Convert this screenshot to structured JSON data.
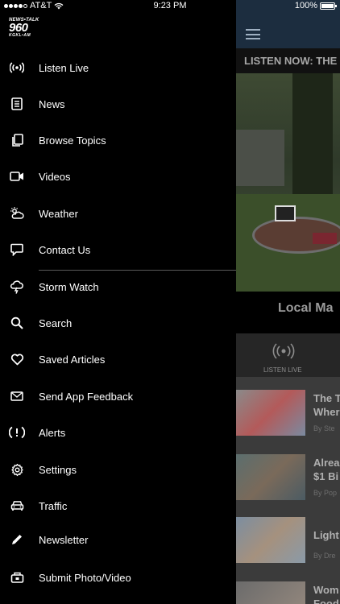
{
  "status_bar": {
    "carrier": "AT&T",
    "time": "9:23 PM",
    "battery": "100%"
  },
  "logo": {
    "line1": "NEWS•TALK",
    "line2": "960",
    "line3": "KGKL•AM"
  },
  "menu": [
    {
      "label": "Listen Live",
      "icon": "radio-broadcast-icon"
    },
    {
      "label": "News",
      "icon": "document-icon"
    },
    {
      "label": "Browse Topics",
      "icon": "copy-pages-icon"
    },
    {
      "label": "Videos",
      "icon": "video-camera-icon"
    },
    {
      "label": "Weather",
      "icon": "weather-icon"
    },
    {
      "label": "Contact Us",
      "icon": "chat-bubble-icon"
    },
    {
      "label": "Storm Watch",
      "icon": "storm-icon"
    },
    {
      "label": "Search",
      "icon": "search-icon"
    },
    {
      "label": "Saved Articles",
      "icon": "heart-icon"
    },
    {
      "label": "Send App Feedback",
      "icon": "envelope-icon"
    },
    {
      "label": "Alerts",
      "icon": "alert-icon"
    },
    {
      "label": "Settings",
      "icon": "gear-icon"
    },
    {
      "label": "Traffic",
      "icon": "car-icon"
    },
    {
      "label": "Newsletter",
      "icon": "pencil-icon"
    },
    {
      "label": "Submit Photo/Video",
      "icon": "camera-upload-icon"
    }
  ],
  "app": {
    "banner": "LISTEN NOW: THE",
    "hero_caption": "Local Ma",
    "tab_listen_live": "LISTEN LIVE",
    "articles": [
      {
        "title": "The T\nWher",
        "byline": "By Ste"
      },
      {
        "title": "Alrea\n$1 Bi",
        "byline": "By Pop"
      },
      {
        "title": "Light",
        "byline": "By Dre"
      },
      {
        "title": "Wom\nFood",
        "byline": ""
      }
    ]
  }
}
